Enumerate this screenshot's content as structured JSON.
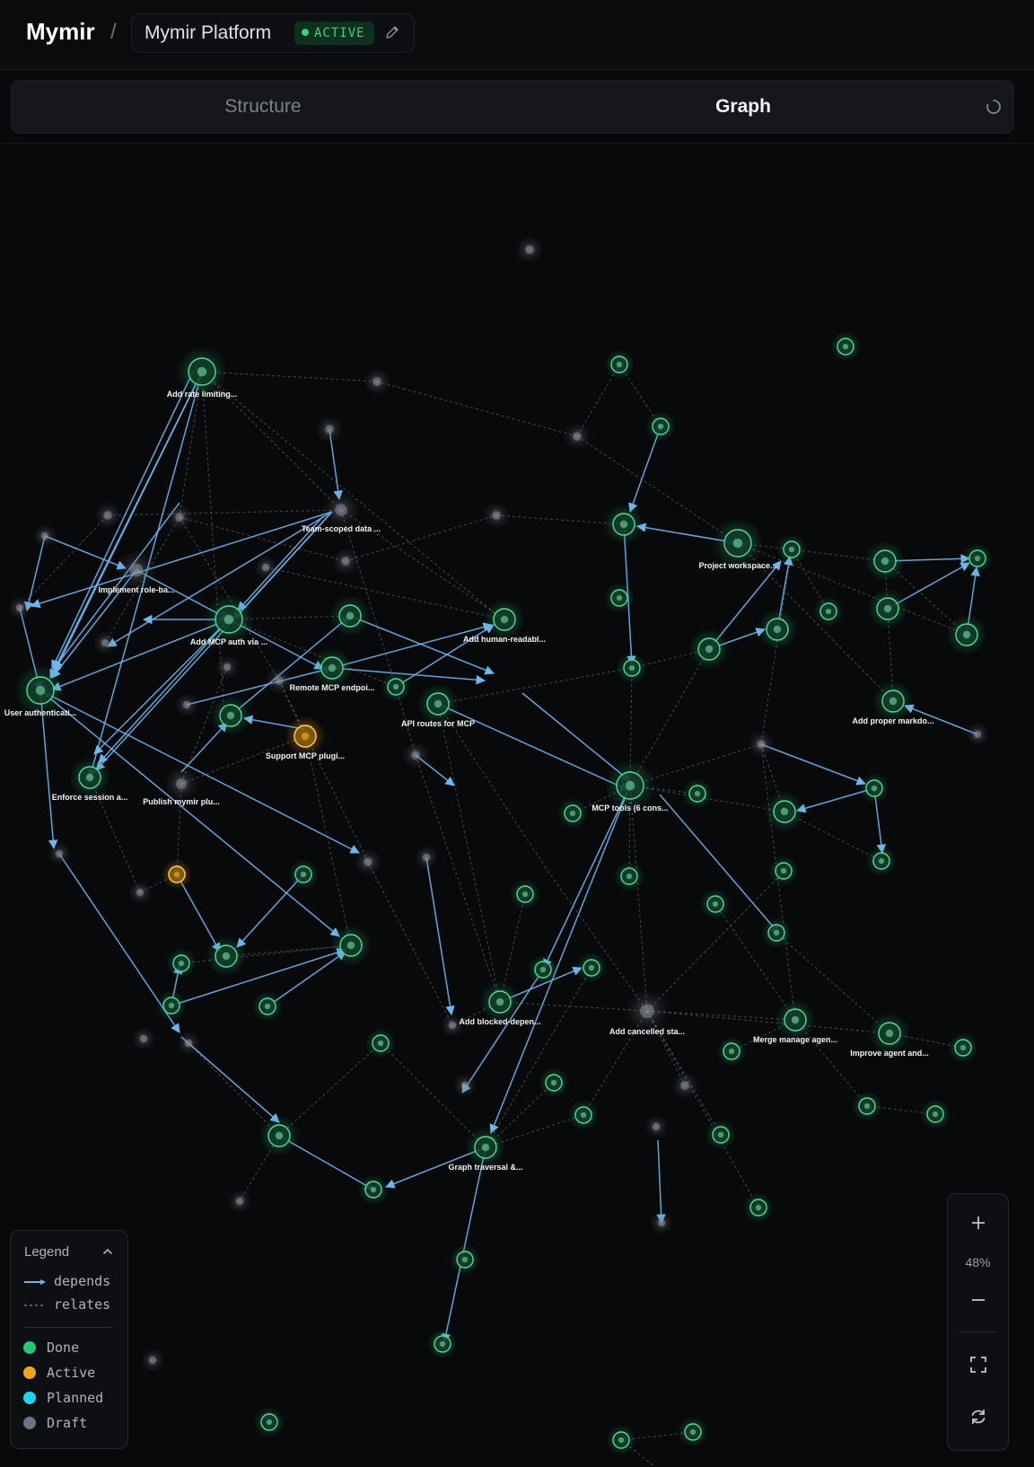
{
  "header": {
    "brand": "Mymir",
    "separator": "/",
    "project_name": "Mymir Platform",
    "status_label": "ACTIVE",
    "status_color": "#3ecf80",
    "edit_icon": "pencil-icon"
  },
  "tabs": [
    {
      "label": "Structure",
      "selected": false
    },
    {
      "label": "Graph",
      "selected": true
    }
  ],
  "tab_action_icon": "spinner-icon",
  "legend": {
    "title": "Legend",
    "collapse_icon": "chevron-up-icon",
    "edge_types": [
      {
        "label": "depends",
        "style": "solid-arrow",
        "color": "#6fb6ee"
      },
      {
        "label": "relates",
        "style": "dashed",
        "color": "#6b7078"
      }
    ],
    "statuses": [
      {
        "label": "Done",
        "color": "#22c77a"
      },
      {
        "label": "Active",
        "color": "#f2a41c"
      },
      {
        "label": "Planned",
        "color": "#22d3ee"
      },
      {
        "label": "Draft",
        "color": "#6b7389"
      }
    ]
  },
  "zoom": {
    "level": "48%",
    "zoom_in_icon": "plus-icon",
    "zoom_out_icon": "minus-icon",
    "fit_icon": "fit-view-icon",
    "reset_icon": "refresh-icon"
  },
  "graph": {
    "labeled_nodes": [
      {
        "label": "Add rate limiting...",
        "status": "Done"
      },
      {
        "label": "Team-scoped data ...",
        "status": "Draft"
      },
      {
        "label": "Implement role-ba...",
        "status": "Draft"
      },
      {
        "label": "Add MCP auth via ...",
        "status": "Done"
      },
      {
        "label": "Add human-readabl...",
        "status": "Done"
      },
      {
        "label": "Project workspace...",
        "status": "Done"
      },
      {
        "label": "User authenticati...",
        "status": "Done"
      },
      {
        "label": "Remote MCP endpoi...",
        "status": "Done"
      },
      {
        "label": "API routes for MCP",
        "status": "Done"
      },
      {
        "label": "Add proper markdo...",
        "status": "Done"
      },
      {
        "label": "Support MCP plugi...",
        "status": "Active"
      },
      {
        "label": "Enforce session a...",
        "status": "Done"
      },
      {
        "label": "Publish mymir plu...",
        "status": "Draft"
      },
      {
        "label": "MCP tools (6 cons...",
        "status": "Done"
      },
      {
        "label": "Add blocked-depen...",
        "status": "Done"
      },
      {
        "label": "Add cancelled sta...",
        "status": "Draft"
      },
      {
        "label": "Merge manage agen...",
        "status": "Done"
      },
      {
        "label": "Improve agent and...",
        "status": "Done"
      },
      {
        "label": "Graph traversal &...",
        "status": "Done"
      }
    ]
  }
}
